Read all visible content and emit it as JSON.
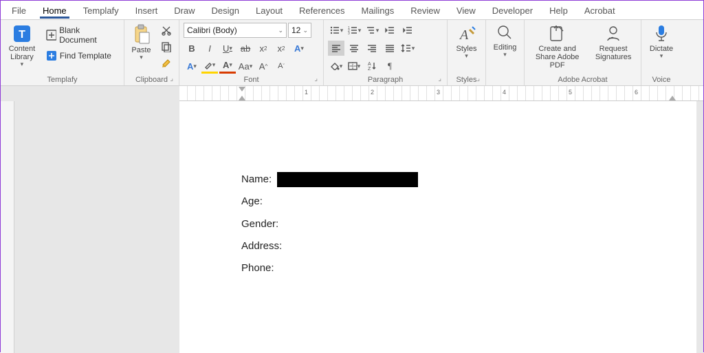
{
  "tabs": [
    "File",
    "Home",
    "Templafy",
    "Insert",
    "Draw",
    "Design",
    "Layout",
    "References",
    "Mailings",
    "Review",
    "View",
    "Developer",
    "Help",
    "Acrobat"
  ],
  "activeTab": "Home",
  "ribbon": {
    "templafy": {
      "label": "Templafy",
      "contentLibrary": "Content Library",
      "blankDoc": "Blank Document",
      "findTemplate": "Find Template"
    },
    "clipboard": {
      "label": "Clipboard",
      "paste": "Paste"
    },
    "font": {
      "label": "Font",
      "name": "Calibri (Body)",
      "size": "12"
    },
    "paragraph": {
      "label": "Paragraph"
    },
    "styles": {
      "label": "Styles",
      "styles": "Styles"
    },
    "editing": {
      "label": "",
      "editing": "Editing"
    },
    "adobe": {
      "label": "Adobe Acrobat",
      "createShare": "Create and Share Adobe PDF",
      "reqSig": "Request Signatures"
    },
    "voice": {
      "label": "Voice",
      "dictate": "Dictate"
    }
  },
  "ruler": {
    "nums": [
      "1",
      "2",
      "3",
      "4",
      "5",
      "6"
    ]
  },
  "document": {
    "fields": [
      "Name:",
      "Age:",
      "Gender:",
      "Address:",
      "Phone:"
    ]
  }
}
